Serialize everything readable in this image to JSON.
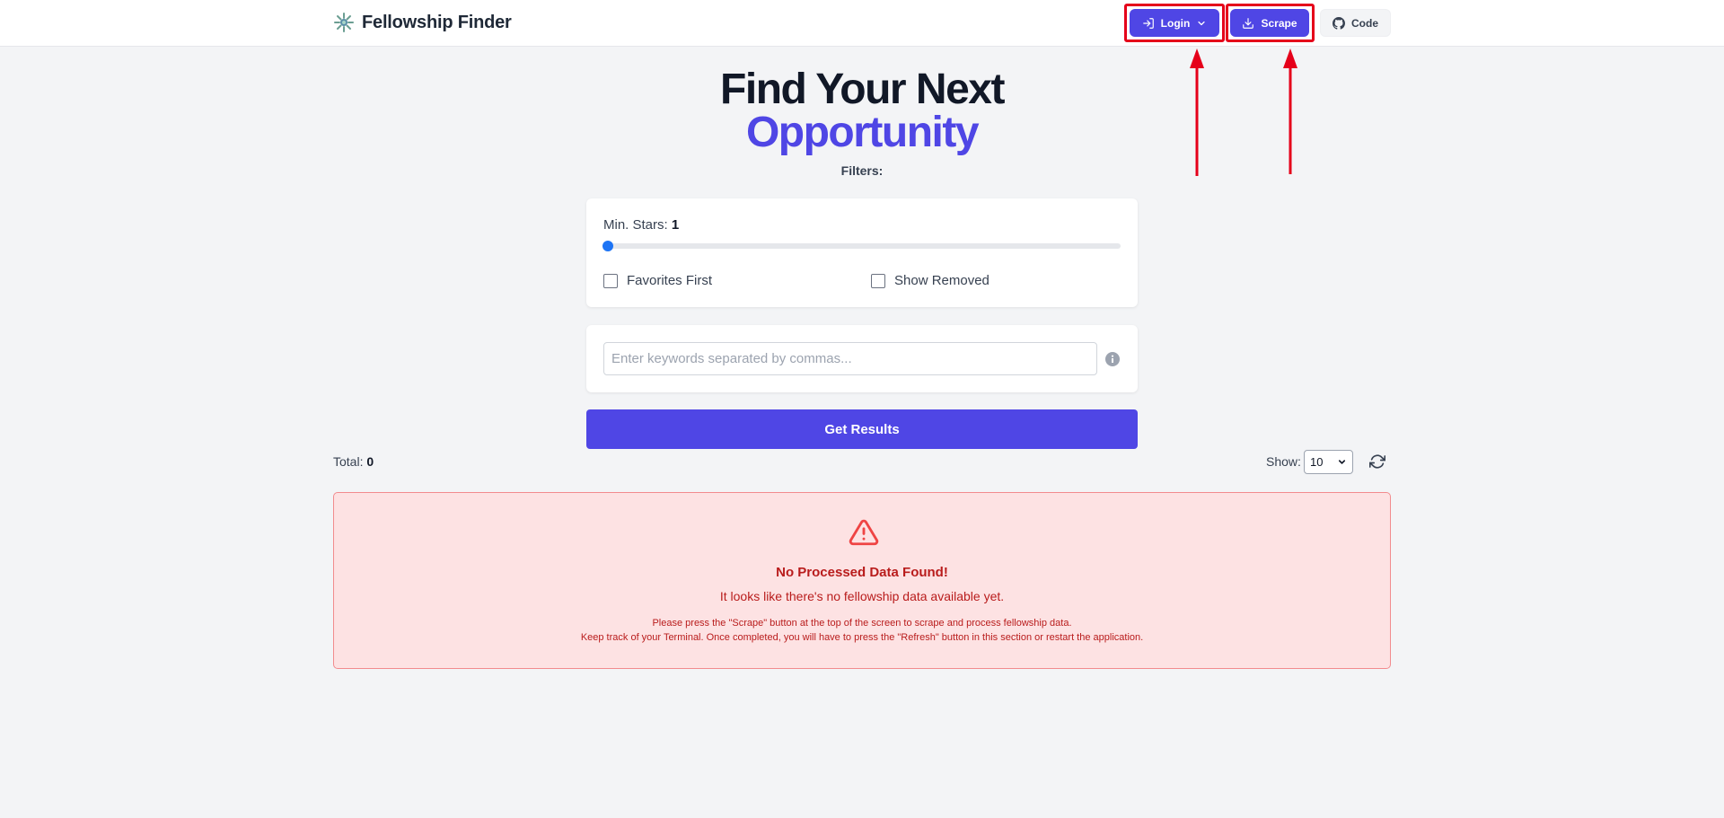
{
  "header": {
    "title": "Fellowship Finder",
    "login_label": "Login",
    "scrape_label": "Scrape",
    "code_label": "Code"
  },
  "hero": {
    "line1": "Find Your Next",
    "line2": "Opportunity",
    "filters_label": "Filters:"
  },
  "filters": {
    "min_stars_label": "Min. Stars:",
    "min_stars_value": "1",
    "min_stars_level": 0,
    "favorites_first_label": "Favorites First",
    "favorites_first_checked": false,
    "show_removed_label": "Show Removed",
    "show_removed_checked": false
  },
  "search": {
    "placeholder": "Enter keywords separated by commas...",
    "value": ""
  },
  "actions": {
    "get_results_label": "Get Results"
  },
  "results": {
    "total_label": "Total:",
    "total_value": "0",
    "show_label": "Show:",
    "page_size": "10"
  },
  "alert": {
    "title": "No Processed Data Found!",
    "subtitle": "It looks like there's no fellowship data available yet.",
    "note1": "Please press the \"Scrape\" button at the top of the screen to scrape and process fellowship data.",
    "note2": "Keep track of your Terminal. Once completed, you will have to press the \"Refresh\" button in this section or restart the application."
  },
  "colors": {
    "accent": "#4f46e5",
    "highlight": "#e5001a",
    "alert_bg": "#fde2e3",
    "alert_text": "#b91c1c"
  },
  "icons": [
    "logo-icon",
    "login-icon",
    "chevron-down-icon",
    "download-icon",
    "github-icon",
    "info-icon",
    "refresh-icon",
    "warning-icon",
    "arrow-up-icon"
  ]
}
